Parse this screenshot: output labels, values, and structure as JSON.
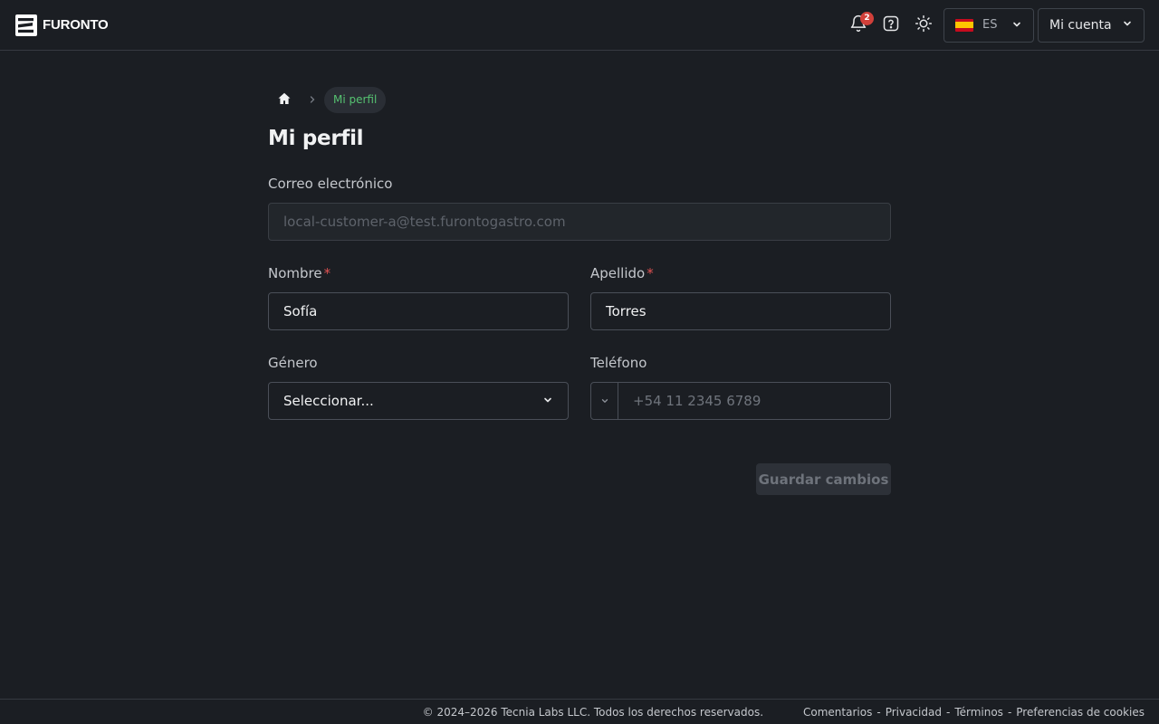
{
  "header": {
    "brand": "FURONTO",
    "notifications_count": "2",
    "language": {
      "code": "ES"
    },
    "account_label": "Mi cuenta"
  },
  "breadcrumb": {
    "current": "Mi perfil"
  },
  "page": {
    "title": "Mi perfil"
  },
  "form": {
    "email": {
      "label": "Correo electrónico",
      "value": "local-customer-a@test.furontogastro.com"
    },
    "first_name": {
      "label": "Nombre",
      "value": "Sofía"
    },
    "last_name": {
      "label": "Apellido",
      "value": "Torres"
    },
    "required_mark": "*",
    "gender": {
      "label": "Género",
      "value": "Seleccionar..."
    },
    "phone": {
      "label": "Teléfono",
      "placeholder": "+54 11 2345 6789"
    },
    "save_label": "Guardar cambios"
  },
  "footer": {
    "copyright": "© 2024–2026 Tecnia Labs LLC. Todos los derechos reservados.",
    "separator": "-",
    "links": [
      "Comentarios",
      "Privacidad",
      "Términos",
      "Preferencias de cookies"
    ]
  }
}
